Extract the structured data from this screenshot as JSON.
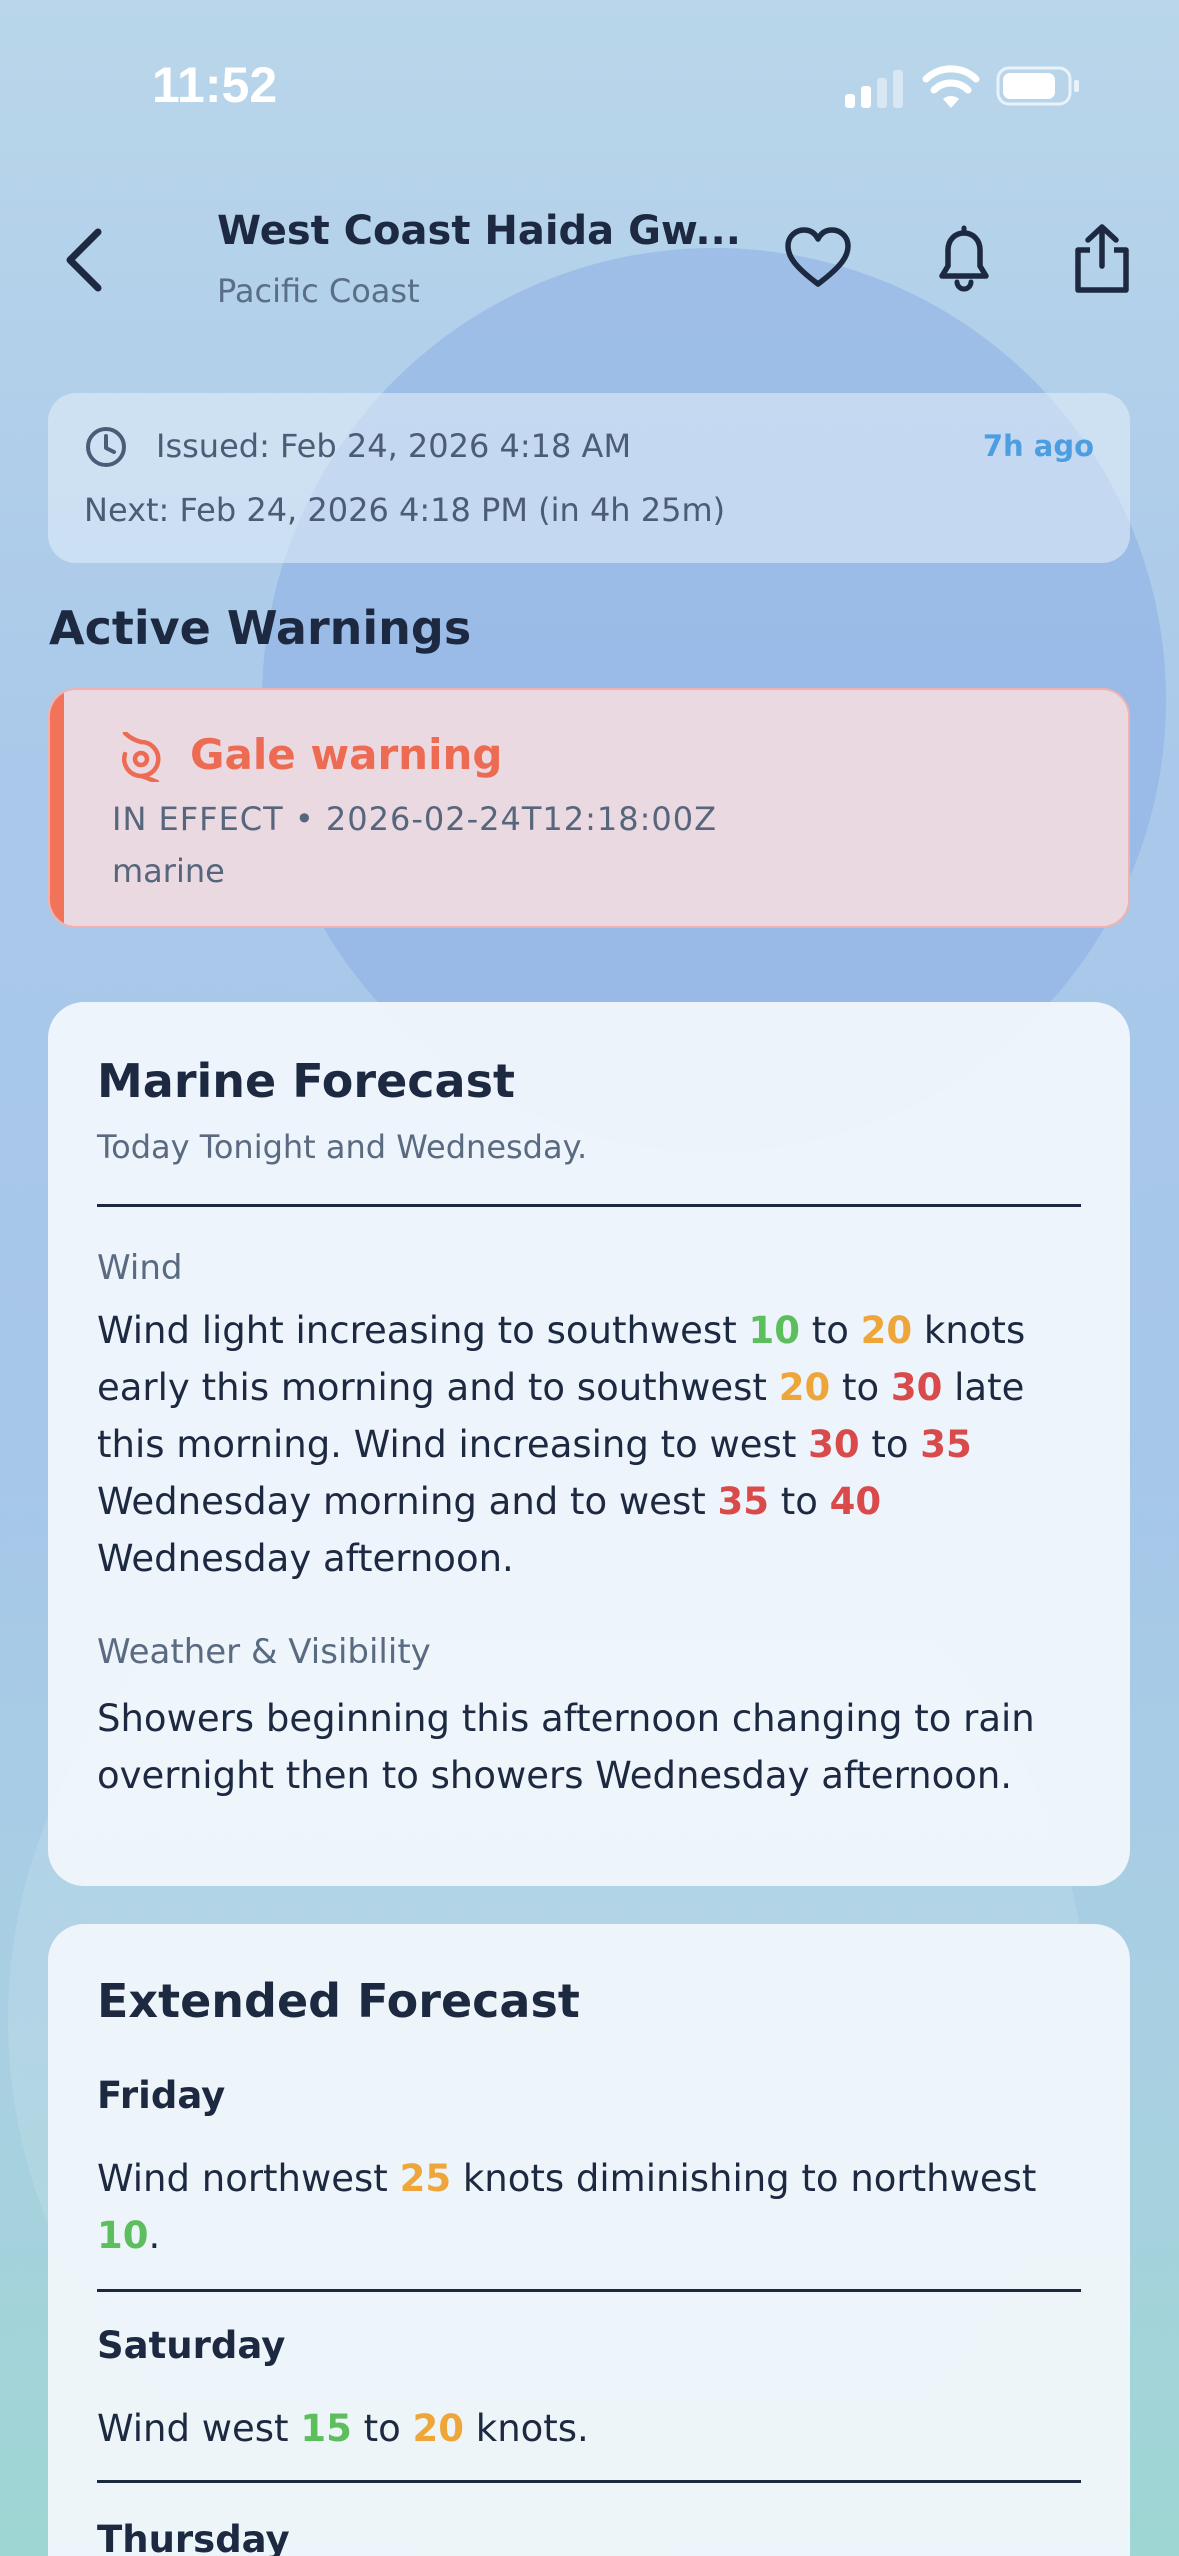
{
  "status_bar": {
    "time": "11:52"
  },
  "header": {
    "title": "West Coast Haida Gw...",
    "subtitle": "Pacific Coast"
  },
  "issued": {
    "issued_label": "Issued: Feb 24, 2026 4:18 AM",
    "ago": "7h ago",
    "next_label": "Next: Feb 24, 2026 4:18 PM (in 4h 25m)"
  },
  "warnings": {
    "section_title": "Active Warnings",
    "items": [
      {
        "title": "Gale warning",
        "meta": "IN EFFECT • 2026-02-24T12:18:00Z",
        "type": "marine"
      }
    ]
  },
  "marine": {
    "title": "Marine Forecast",
    "subtitle": "Today Tonight and Wednesday.",
    "wind_label": "Wind",
    "wind": {
      "t1": "Wind light increasing to southwest ",
      "v1": "10",
      "t2": " to ",
      "v2": "20",
      "t3": " knots early this morning and to southwest ",
      "v3": "20",
      "t4": " to ",
      "v4": "30",
      "t5": " late this morning. Wind increasing to west ",
      "v5": "30",
      "t6": " to ",
      "v6": "35",
      "t7": " Wednesday morning and to west ",
      "v7": "35",
      "t8": " to ",
      "v8": "40",
      "t9": " Wednesday afternoon."
    },
    "weather_label": "Weather & Visibility",
    "weather_text": "Showers beginning this afternoon changing to rain overnight then to showers Wednesday afternoon."
  },
  "extended": {
    "title": "Extended Forecast",
    "days": [
      {
        "day": "Friday",
        "t1": "Wind northwest ",
        "v1": "25",
        "t2": " knots diminishing to  northwest ",
        "v2": "10",
        "t3": "."
      },
      {
        "day": "Saturday",
        "t1": "Wind west ",
        "v1": "15",
        "t2": " to ",
        "v2": "20",
        "t3": " knots."
      },
      {
        "day": "Thursday"
      }
    ]
  },
  "colors": {
    "calm_wind": "#5cbe5c",
    "moderate_wind": "#eea63a",
    "strong_wind": "#d94a4a",
    "warning": "#ec6b52",
    "accent": "#4c9ee0"
  }
}
